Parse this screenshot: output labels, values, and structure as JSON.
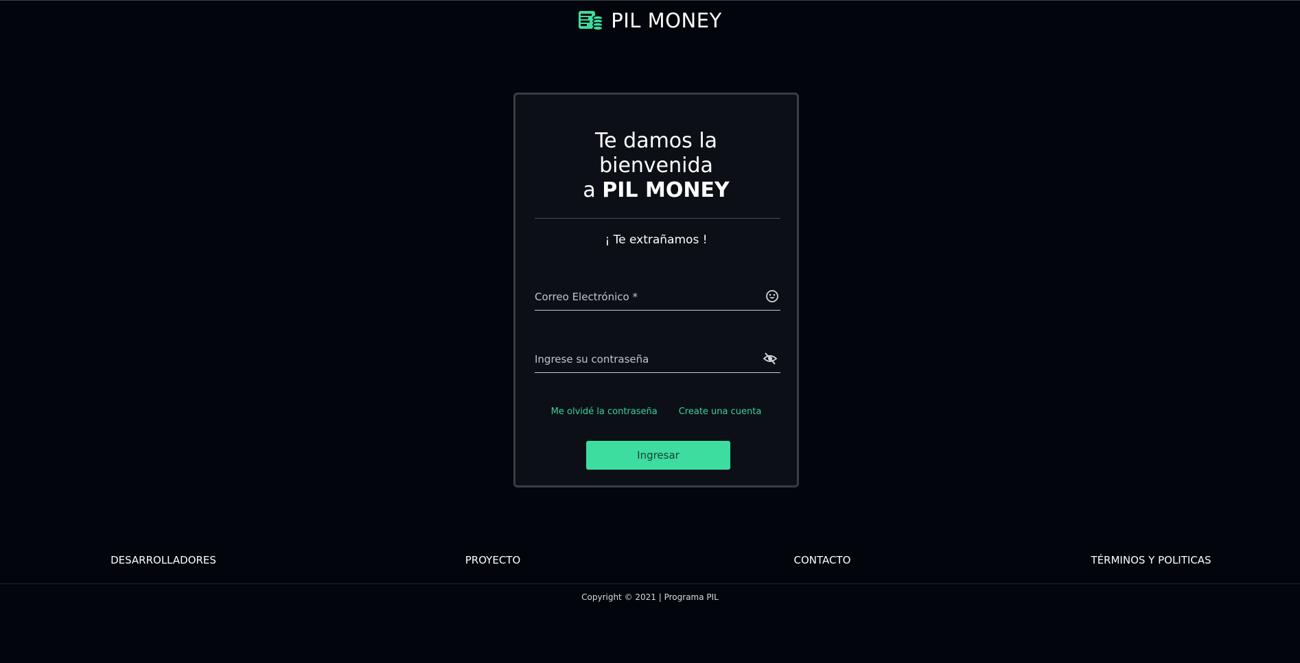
{
  "header": {
    "brand_name": "PIL MONEY",
    "brand_icon": "coins-wallet-icon"
  },
  "login": {
    "welcome_line1": "Te damos la",
    "welcome_line2": "bienvenida",
    "welcome_prefix": "a ",
    "welcome_brand": "PIL MONEY",
    "subtitle": "¡ Te extrañamos !",
    "email_placeholder": "Correo Electrónico *",
    "email_icon": "smiley-icon",
    "password_placeholder": "Ingrese su contraseña",
    "password_icon": "eye-off-icon",
    "forgot_link": "Me olvidé la contraseña",
    "create_link": "Create una cuenta",
    "submit_label": "Ingresar"
  },
  "footer": {
    "links": [
      "DESARROLLADORES",
      "PROYECTO",
      "CONTACTO",
      "TÉRMINOS Y POLITICAS"
    ],
    "copyright": "Copyright © 2021 | Programa PIL"
  },
  "colors": {
    "background": "#02050b",
    "card": "#0c1016",
    "accent": "#3ddc9f",
    "link": "#3ad29d"
  }
}
